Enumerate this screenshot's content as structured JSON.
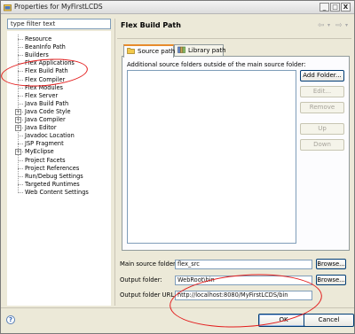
{
  "window": {
    "title": "Properties for MyFirstLCDS",
    "min_label": "_",
    "max_label": "□",
    "close_label": "X"
  },
  "filter": {
    "value": "type filter text"
  },
  "tree": {
    "items": [
      {
        "label": "Resource"
      },
      {
        "label": "BeanInfo Path"
      },
      {
        "label": "Builders"
      },
      {
        "label": "Flex Applications"
      },
      {
        "label": "Flex Build Path"
      },
      {
        "label": "Flex Compiler"
      },
      {
        "label": "Flex Modules"
      },
      {
        "label": "Flex Server"
      },
      {
        "label": "Java Build Path"
      },
      {
        "label": "Java Code Style"
      },
      {
        "label": "Java Compiler"
      },
      {
        "label": "Java Editor"
      },
      {
        "label": "Javadoc Location"
      },
      {
        "label": "JSP Fragment"
      },
      {
        "label": "MyEclipse"
      },
      {
        "label": "Project Facets"
      },
      {
        "label": "Project References"
      },
      {
        "label": "Run/Debug Settings"
      },
      {
        "label": "Targeted Runtimes"
      },
      {
        "label": "Web Content Settings"
      }
    ],
    "expander_symbol": "+"
  },
  "page": {
    "title": "Flex Build Path",
    "nav_back": "⇦",
    "nav_fwd": "⇨",
    "nav_drop": "▾"
  },
  "tabs": [
    {
      "label": "Source path"
    },
    {
      "label": "Library path"
    }
  ],
  "source_path": {
    "description": "Additional source folders outside of the main source folder:",
    "buttons": {
      "add_folder": "Add Folder...",
      "edit": "Edit...",
      "remove": "Remove",
      "up": "Up",
      "down": "Down"
    }
  },
  "fields": {
    "main_source_folder": {
      "label": "Main source folder:",
      "value": "flex_src"
    },
    "output_folder": {
      "label": "Output folder:",
      "value": "WebRoot\\bin"
    },
    "output_folder_url": {
      "label": "Output folder URL:",
      "value": "http://localhost:8080/MyFirstLCDS/bin"
    },
    "browse_label": "Browse..."
  },
  "dialog": {
    "help": "?",
    "ok": "OK",
    "cancel": "Cancel"
  },
  "colors": {
    "annotation": "#e31c1c",
    "active_tab_accent": "#e68b2c"
  }
}
